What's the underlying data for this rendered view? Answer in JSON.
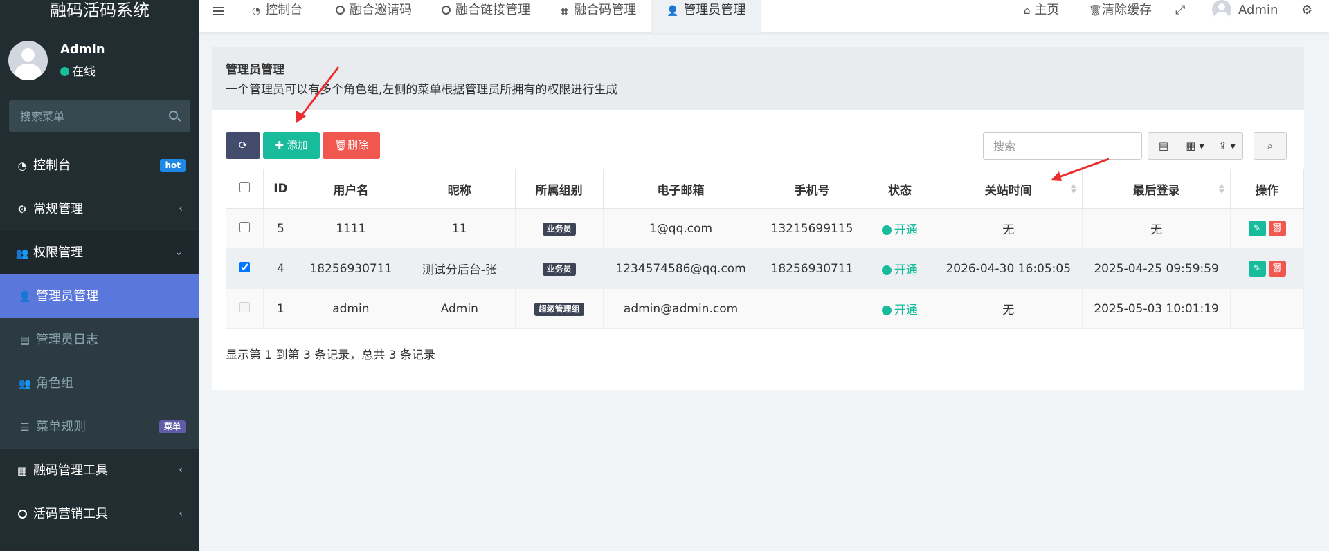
{
  "sidebar": {
    "brand": "融码活码系统",
    "user_name": "Admin",
    "user_status": "在线",
    "search_placeholder": "搜索菜单",
    "items": [
      {
        "label": "控制台",
        "badge": "hot",
        "icon": "dashboard-icon"
      },
      {
        "label": "常规管理",
        "icon": "cogs-icon"
      },
      {
        "label": "权限管理",
        "icon": "group-icon"
      },
      {
        "label": "管理员管理",
        "icon": "user-icon"
      },
      {
        "label": "管理员日志",
        "icon": "list-alt-icon"
      },
      {
        "label": "角色组",
        "icon": "group-icon"
      },
      {
        "label": "菜单规则",
        "badge": "菜单",
        "icon": "bars-icon"
      },
      {
        "label": "融码管理工具",
        "icon": "qrcode-icon"
      },
      {
        "label": "活码营销工具",
        "icon": "circle-icon"
      }
    ]
  },
  "header": {
    "tabs": [
      {
        "label": "控制台",
        "icon": "dashboard-icon"
      },
      {
        "label": "融合邀请码",
        "icon": "circle-icon"
      },
      {
        "label": "融合链接管理",
        "icon": "circle-icon"
      },
      {
        "label": "融合码管理",
        "icon": "qrcode-icon"
      },
      {
        "label": "管理员管理",
        "icon": "user-icon"
      }
    ],
    "home": "主页",
    "clear_cache": "清除缓存",
    "admin": "Admin"
  },
  "panel": {
    "title": "管理员管理",
    "description": "一个管理员可以有多个角色组,左侧的菜单根据管理员所拥有的权限进行生成"
  },
  "toolbar": {
    "add": "添加",
    "delete": "删除",
    "search_placeholder": "搜索"
  },
  "table": {
    "columns": [
      "ID",
      "用户名",
      "昵称",
      "所属组别",
      "电子邮箱",
      "手机号",
      "状态",
      "关站时间",
      "最后登录",
      "操作"
    ],
    "rows": [
      {
        "id": "5",
        "username": "1111",
        "nickname": "11",
        "group": "业务员",
        "email": "1@qq.com",
        "mobile": "13215699115",
        "status": "开通",
        "close_time": "无",
        "last_login": "无"
      },
      {
        "id": "4",
        "username": "18256930711",
        "nickname": "测试分后台-张",
        "group": "业务员",
        "email": "1234574586@qq.com",
        "mobile": "18256930711",
        "status": "开通",
        "close_time": "2026-04-30 16:05:05",
        "last_login": "2025-04-25 09:59:59"
      },
      {
        "id": "1",
        "username": "admin",
        "nickname": "Admin",
        "group": "超级管理组",
        "email": "admin@admin.com",
        "mobile": "",
        "status": "开通",
        "close_time": "无",
        "last_login": "2025-05-03 10:01:19"
      }
    ]
  },
  "pagination": {
    "info": "显示第 1 到第 3 条记录，总共 3 条记录"
  },
  "colors": {
    "sidebar_bg": "#222d32",
    "active_menu": "#5a78db",
    "success": "#18bc9c",
    "danger": "#f0574f",
    "arrow": "#ec2e2e"
  }
}
